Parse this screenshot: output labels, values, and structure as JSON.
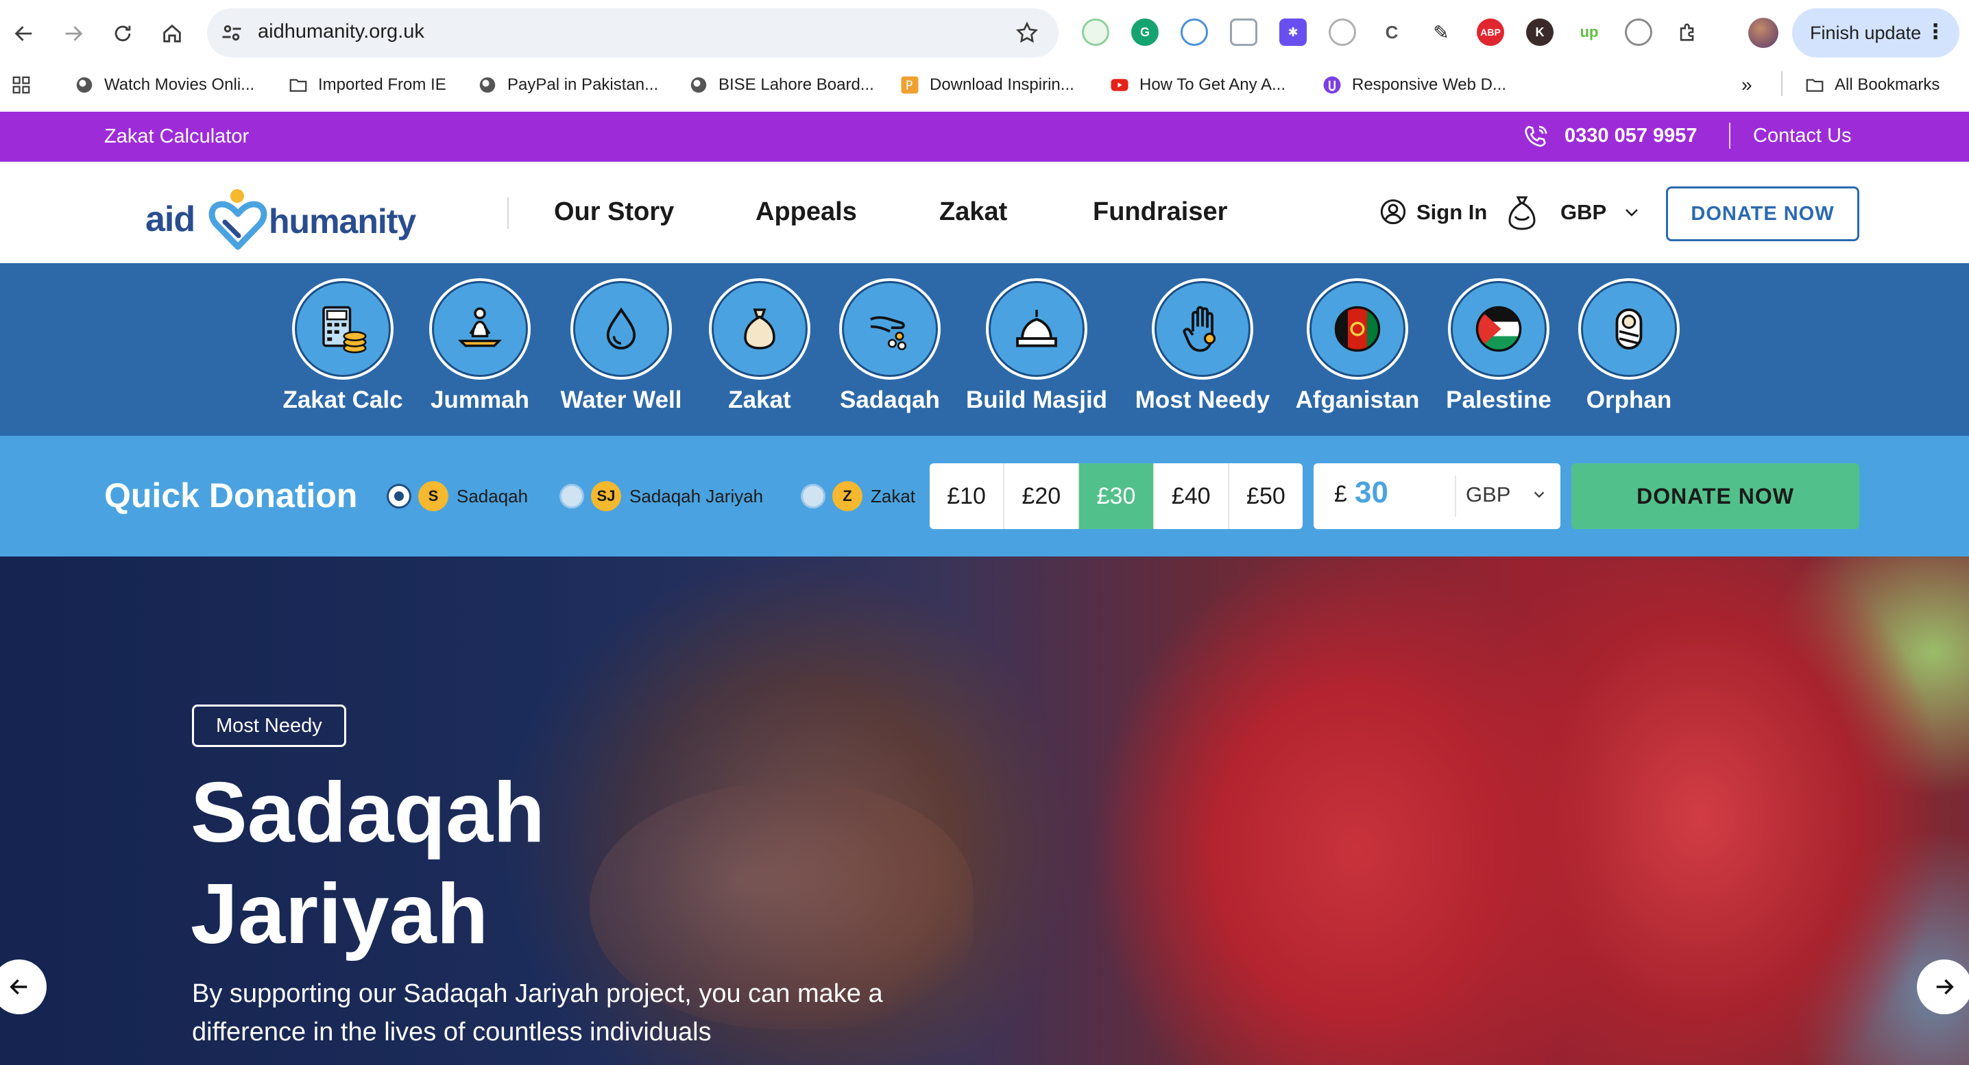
{
  "browser": {
    "url": "aidhumanity.org.uk",
    "finish_update": "Finish update",
    "bookmarks": [
      "Watch Movies Onli...",
      "Imported From IE",
      "PayPal in Pakistan...",
      "BISE Lahore Board...",
      "Download Inspirin...",
      "How To Get Any A...",
      "Responsive Web D..."
    ],
    "all_bookmarks": "All Bookmarks",
    "overflow": "»",
    "extensions": [
      "ABP",
      "K",
      "up"
    ]
  },
  "topbar": {
    "calculator": "Zakat Calculator",
    "phone": "0330 057 9957",
    "contact": "Contact Us",
    "color": "#9d2cd8"
  },
  "header": {
    "logo_left": "aid",
    "logo_right": "humanity",
    "nav": [
      "Our Story",
      "Appeals",
      "Zakat",
      "Fundraiser"
    ],
    "sign_in": "Sign In",
    "currency": "GBP",
    "donate": "DONATE NOW"
  },
  "categories": [
    {
      "label": "Zakat Calc",
      "icon": "calculator-coins-icon"
    },
    {
      "label": "Jummah",
      "icon": "praying-person-icon"
    },
    {
      "label": "Water Well",
      "icon": "water-drop-icon"
    },
    {
      "label": "Zakat",
      "icon": "money-bag-icon"
    },
    {
      "label": "Sadaqah",
      "icon": "giving-hand-icon"
    },
    {
      "label": "Build Masjid",
      "icon": "mosque-dome-icon"
    },
    {
      "label": "Most Needy",
      "icon": "raised-hand-icon"
    },
    {
      "label": "Afganistan",
      "icon": "afghanistan-flag-icon"
    },
    {
      "label": "Palestine",
      "icon": "palestine-flag-icon"
    },
    {
      "label": "Orphan",
      "icon": "baby-icon"
    }
  ],
  "quick": {
    "title": "Quick Donation",
    "types": [
      {
        "badge": "S",
        "label": "Sadaqah",
        "selected": true
      },
      {
        "badge": "SJ",
        "label": "Sadaqah Jariyah",
        "selected": false
      },
      {
        "badge": "Z",
        "label": "Zakat",
        "selected": false
      }
    ],
    "amounts": [
      "£10",
      "£20",
      "£30",
      "£40",
      "£50"
    ],
    "selected_amount": "£30",
    "custom_symbol": "£",
    "custom_value": "30",
    "currency": "GBP",
    "donate": "DONATE NOW",
    "accent": "#52c08a"
  },
  "hero": {
    "tag": "Most Needy",
    "title_line1": "Sadaqah",
    "title_line2": "Jariyah",
    "description": "By supporting our Sadaqah Jariyah project, you can make a difference in the lives of countless individuals"
  }
}
